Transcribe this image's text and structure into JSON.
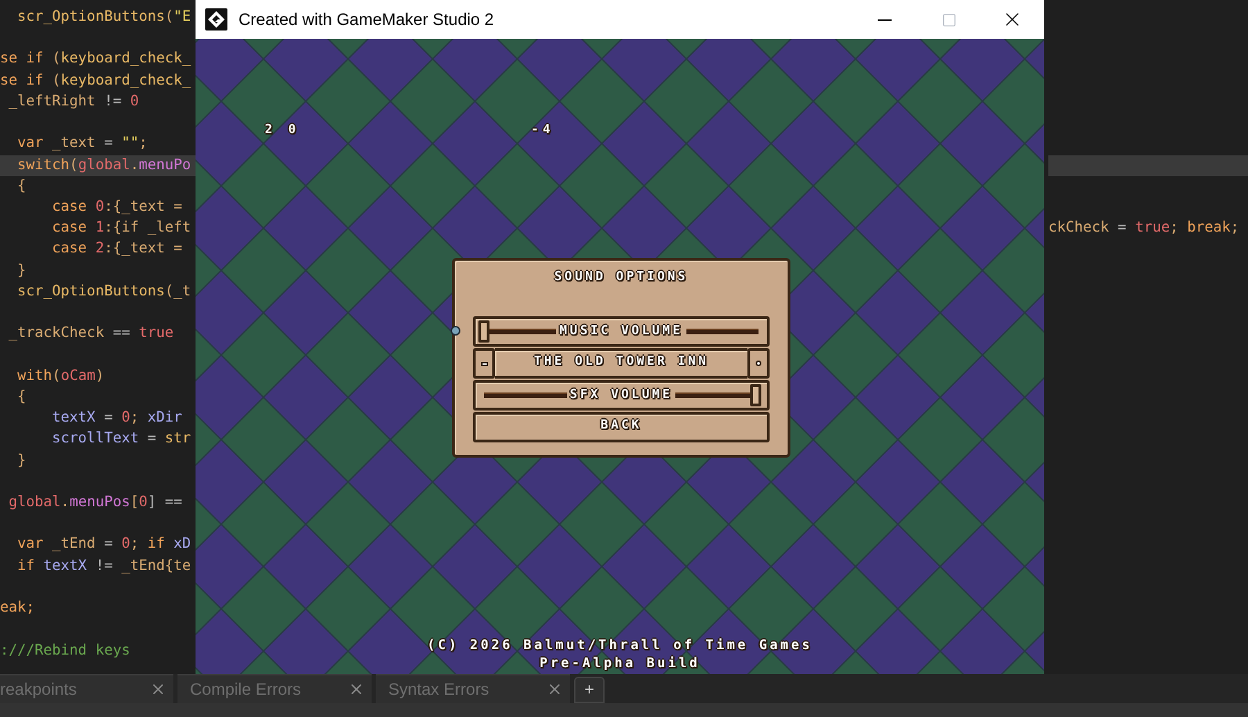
{
  "editor": {
    "lines": [
      {
        "kind": "code",
        "highlighted": false,
        "segments": [
          {
            "text": "  scr_OptionButtons",
            "kind": "func"
          },
          {
            "text": "(",
            "kind": "plain"
          },
          {
            "text": "\"E",
            "kind": "str"
          }
        ]
      },
      {
        "kind": "blank",
        "highlighted": false
      },
      {
        "kind": "code",
        "highlighted": false,
        "segments": [
          {
            "text": "se if",
            "kind": "keyword"
          },
          {
            "text": " (",
            "kind": "plain"
          },
          {
            "text": "keyboard_check_",
            "kind": "func"
          }
        ]
      },
      {
        "kind": "code",
        "highlighted": false,
        "segments": [
          {
            "text": "se if",
            "kind": "keyword"
          },
          {
            "text": " (",
            "kind": "plain"
          },
          {
            "text": "keyboard_check_",
            "kind": "func"
          }
        ]
      },
      {
        "kind": "code",
        "highlighted": false,
        "segments": [
          {
            "text": " _leftRight",
            "kind": "plain"
          },
          {
            "text": " != ",
            "kind": "op"
          },
          {
            "text": "0",
            "kind": "num"
          }
        ]
      },
      {
        "kind": "blank",
        "highlighted": false
      },
      {
        "kind": "code",
        "highlighted": false,
        "segments": [
          {
            "text": "  var",
            "kind": "keyword"
          },
          {
            "text": " _text",
            "kind": "plain"
          },
          {
            "text": " = ",
            "kind": "op"
          },
          {
            "text": "\"\"",
            "kind": "str"
          },
          {
            "text": ";",
            "kind": "plain"
          }
        ]
      },
      {
        "kind": "code",
        "highlighted": true,
        "segments": [
          {
            "text": "  switch",
            "kind": "keyword"
          },
          {
            "text": "(",
            "kind": "plain"
          },
          {
            "text": "global",
            "kind": "global"
          },
          {
            "text": ".",
            "kind": "plain"
          },
          {
            "text": "menuPo",
            "kind": "field"
          }
        ]
      },
      {
        "kind": "code",
        "highlighted": false,
        "segments": [
          {
            "text": "  {",
            "kind": "plain"
          }
        ]
      },
      {
        "kind": "code",
        "highlighted": false,
        "segments": [
          {
            "text": "      case",
            "kind": "keyword"
          },
          {
            "text": " 0",
            "kind": "num"
          },
          {
            "text": ":{_text =",
            "kind": "plain"
          }
        ]
      },
      {
        "kind": "code",
        "highlighted": false,
        "segments": [
          {
            "text": "      case",
            "kind": "keyword"
          },
          {
            "text": " 1",
            "kind": "num"
          },
          {
            "text": ":{if _left",
            "kind": "plain"
          }
        ],
        "right_segments": [
          {
            "text": "ckCheck",
            "kind": "plain"
          },
          {
            "text": " = ",
            "kind": "op"
          },
          {
            "text": "true",
            "kind": "num"
          },
          {
            "text": "; ",
            "kind": "plain"
          },
          {
            "text": "break",
            "kind": "keyword"
          },
          {
            "text": ";",
            "kind": "plain"
          }
        ]
      },
      {
        "kind": "code",
        "highlighted": false,
        "segments": [
          {
            "text": "      case",
            "kind": "keyword"
          },
          {
            "text": " 2",
            "kind": "num"
          },
          {
            "text": ":{_text =",
            "kind": "plain"
          }
        ]
      },
      {
        "kind": "code",
        "highlighted": false,
        "segments": [
          {
            "text": "  }",
            "kind": "plain"
          }
        ]
      },
      {
        "kind": "code",
        "highlighted": false,
        "segments": [
          {
            "text": "  scr_OptionButtons",
            "kind": "func"
          },
          {
            "text": "(_t",
            "kind": "plain"
          }
        ]
      },
      {
        "kind": "blank",
        "highlighted": false
      },
      {
        "kind": "code",
        "highlighted": false,
        "segments": [
          {
            "text": " _trackCheck",
            "kind": "plain"
          },
          {
            "text": " == ",
            "kind": "op"
          },
          {
            "text": "true",
            "kind": "num"
          }
        ]
      },
      {
        "kind": "blank",
        "highlighted": false
      },
      {
        "kind": "code",
        "highlighted": false,
        "segments": [
          {
            "text": "  with",
            "kind": "keyword"
          },
          {
            "text": "(",
            "kind": "plain"
          },
          {
            "text": "oCam",
            "kind": "global"
          },
          {
            "text": ")",
            "kind": "plain"
          }
        ]
      },
      {
        "kind": "code",
        "highlighted": false,
        "segments": [
          {
            "text": "  {",
            "kind": "plain"
          }
        ]
      },
      {
        "kind": "code",
        "highlighted": false,
        "segments": [
          {
            "text": "      textX",
            "kind": "var"
          },
          {
            "text": " = ",
            "kind": "op"
          },
          {
            "text": "0",
            "kind": "num"
          },
          {
            "text": "; ",
            "kind": "plain"
          },
          {
            "text": "xDir",
            "kind": "var"
          }
        ]
      },
      {
        "kind": "code",
        "highlighted": false,
        "segments": [
          {
            "text": "      scrollText",
            "kind": "var"
          },
          {
            "text": " = ",
            "kind": "op"
          },
          {
            "text": "str",
            "kind": "func"
          }
        ]
      },
      {
        "kind": "code",
        "highlighted": false,
        "segments": [
          {
            "text": "  }",
            "kind": "plain"
          }
        ]
      },
      {
        "kind": "blank",
        "highlighted": false
      },
      {
        "kind": "code",
        "highlighted": false,
        "segments": [
          {
            "text": " global",
            "kind": "global"
          },
          {
            "text": ".",
            "kind": "plain"
          },
          {
            "text": "menuPos",
            "kind": "field"
          },
          {
            "text": "[",
            "kind": "plain"
          },
          {
            "text": "0",
            "kind": "num"
          },
          {
            "text": "] ==",
            "kind": "op"
          }
        ]
      },
      {
        "kind": "blank",
        "highlighted": false
      },
      {
        "kind": "code",
        "highlighted": false,
        "segments": [
          {
            "text": "  var",
            "kind": "keyword"
          },
          {
            "text": " _tEnd",
            "kind": "plain"
          },
          {
            "text": " = ",
            "kind": "op"
          },
          {
            "text": "0",
            "kind": "num"
          },
          {
            "text": "; ",
            "kind": "plain"
          },
          {
            "text": "if",
            "kind": "keyword"
          },
          {
            "text": " xD",
            "kind": "var"
          }
        ]
      },
      {
        "kind": "code",
        "highlighted": false,
        "segments": [
          {
            "text": "  if",
            "kind": "keyword"
          },
          {
            "text": " textX",
            "kind": "var"
          },
          {
            "text": " != ",
            "kind": "op"
          },
          {
            "text": "_tEnd",
            "kind": "plain"
          },
          {
            "text": "{te",
            "kind": "plain"
          }
        ]
      },
      {
        "kind": "blank",
        "highlighted": false
      },
      {
        "kind": "code",
        "highlighted": false,
        "segments": [
          {
            "text": "eak;",
            "kind": "keyword"
          }
        ]
      },
      {
        "kind": "blank",
        "highlighted": false
      },
      {
        "kind": "code",
        "highlighted": false,
        "segments": [
          {
            "text": ":///Rebind keys",
            "kind": "comment"
          }
        ]
      }
    ]
  },
  "game_window": {
    "title": "Created with GameMaker Studio 2",
    "hud": [
      {
        "text": "2 0"
      },
      {
        "text": "-4"
      }
    ],
    "menu": {
      "title": "SOUND OPTIONS",
      "items": [
        {
          "kind": "slider",
          "label": "MUSIC VOLUME",
          "level": 0,
          "selected": true
        },
        {
          "kind": "selector",
          "label": "THE OLD TOWER INN",
          "selected": false
        },
        {
          "kind": "slider",
          "label": "SFX VOLUME",
          "level": 1,
          "selected": false
        },
        {
          "kind": "button",
          "label": "BACK",
          "selected": false
        }
      ]
    },
    "footer": [
      "(C) 2026 Balmut/Thrall of Time Games",
      "Pre-Alpha Build"
    ]
  },
  "bottom_tabs": [
    {
      "label": "reakpoints"
    },
    {
      "label": "Compile Errors"
    },
    {
      "label": "Syntax Errors"
    }
  ],
  "add_tab": {
    "label": "+"
  }
}
